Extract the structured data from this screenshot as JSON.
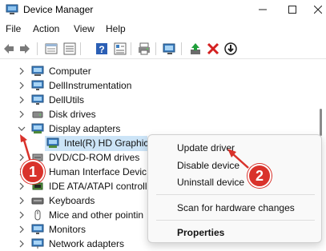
{
  "window": {
    "title": "Device Manager"
  },
  "menu": [
    "File",
    "Action",
    "View",
    "Help"
  ],
  "tree": [
    {
      "label": "Computer",
      "icon": "computer-icon"
    },
    {
      "label": "DellInstrumentation",
      "icon": "monitor-icon"
    },
    {
      "label": "DellUtils",
      "icon": "monitor-icon"
    },
    {
      "label": "Disk drives",
      "icon": "disk-icon"
    },
    {
      "label": "Display adapters",
      "icon": "display-adapter-icon"
    },
    {
      "label": "Intel(R) HD Graphic",
      "icon": "display-adapter-icon"
    },
    {
      "label": "DVD/CD-ROM drives",
      "icon": "dvd-icon"
    },
    {
      "label": "Human Interface Devic",
      "icon": "hid-icon"
    },
    {
      "label": "IDE ATA/ATAPI controlle",
      "icon": "ide-icon"
    },
    {
      "label": "Keyboards",
      "icon": "keyboard-icon"
    },
    {
      "label": "Mice and other pointin",
      "icon": "mouse-icon"
    },
    {
      "label": "Monitors",
      "icon": "monitor-icon"
    },
    {
      "label": "Network adapters",
      "icon": "network-icon"
    }
  ],
  "context_menu": {
    "update": "Update driver",
    "disable": "Disable device",
    "uninstall": "Uninstall device",
    "scan": "Scan for hardware changes",
    "properties": "Properties"
  },
  "annotations": {
    "badge1": "1",
    "badge2": "2",
    "color": "#d9322b"
  }
}
